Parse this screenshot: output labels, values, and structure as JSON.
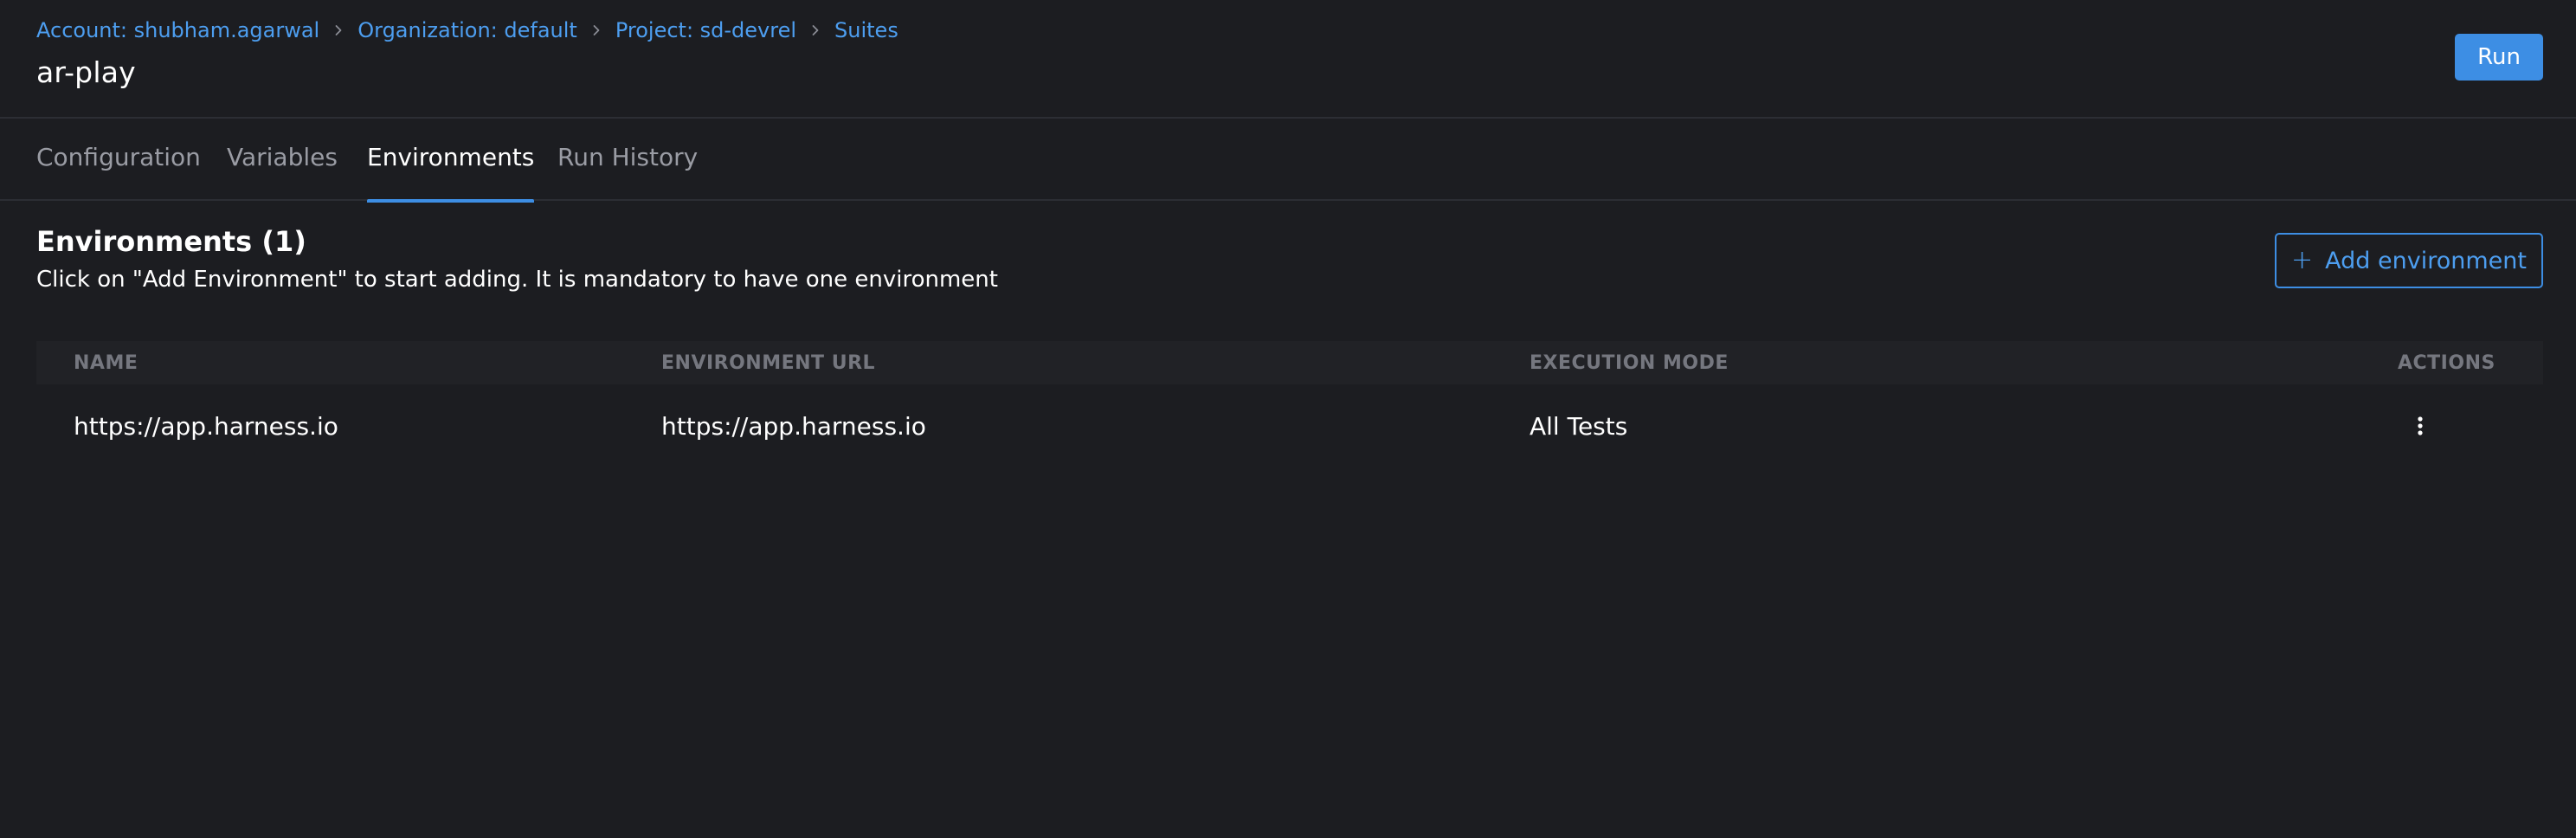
{
  "breadcrumb": [
    {
      "label": "Account: shubham.agarwal"
    },
    {
      "label": "Organization: default"
    },
    {
      "label": "Project: sd-devrel"
    },
    {
      "label": "Suites"
    }
  ],
  "header": {
    "title": "ar-play",
    "run_label": "Run"
  },
  "tabs": [
    {
      "label": "Configuration",
      "active": false
    },
    {
      "label": "Variables",
      "active": false
    },
    {
      "label": "Environments",
      "active": true
    },
    {
      "label": "Run History",
      "active": false
    }
  ],
  "section": {
    "title": "Environments (1)",
    "description": "Click on \"Add Environment\" to start adding. It is mandatory to have one environment",
    "add_label": "Add environment",
    "add_icon": "plus-icon"
  },
  "table": {
    "columns": [
      "NAME",
      "ENVIRONMENT URL",
      "EXECUTION MODE",
      "ACTIONS"
    ],
    "rows": [
      {
        "name": "https://app.harness.io",
        "url": "https://app.harness.io",
        "mode": "All Tests",
        "action_icon": "kebab-menu-icon"
      }
    ]
  },
  "colors": {
    "background": "#1c1d21",
    "accent": "#3d8ee4",
    "link": "#4d9ef0",
    "muted_text": "#9a9ca4",
    "header_text": "#75777f"
  }
}
